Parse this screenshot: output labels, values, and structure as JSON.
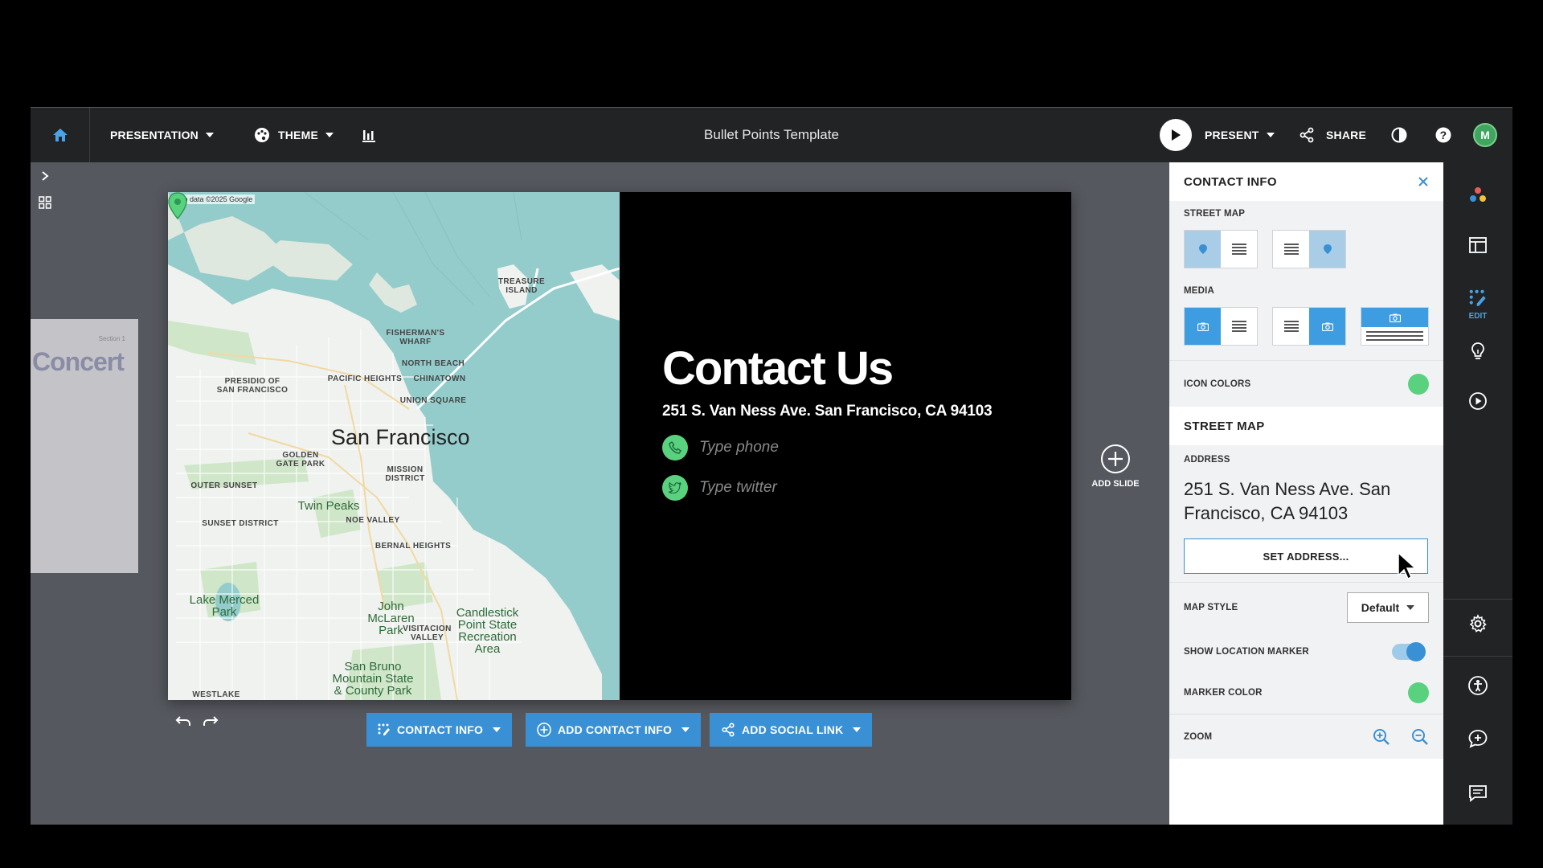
{
  "topbar": {
    "presentation_label": "PRESENTATION",
    "theme_label": "THEME",
    "doc_title": "Bullet Points Template",
    "present_label": "PRESENT",
    "share_label": "SHARE",
    "avatar_initial": "M"
  },
  "thumbnail": {
    "section": "Section 1",
    "title": "Concert"
  },
  "map": {
    "credit": "Map data ©2025 Google",
    "city": "San Francisco",
    "labels": {
      "treasure_island": "TREASURE ISLAND",
      "fishermans_wharf": "FISHERMAN'S WHARF",
      "north_beach": "NORTH BEACH",
      "presidio": "PRESIDIO OF SAN FRANCISCO",
      "pacific_heights": "PACIFIC HEIGHTS",
      "chinatown": "CHINATOWN",
      "union_square": "UNION SQUARE",
      "golden_gate_park": "GOLDEN GATE PARK",
      "mission_district": "MISSION DISTRICT",
      "outer_sunset": "OUTER SUNSET",
      "twin_peaks": "Twin Peaks",
      "noe_valley": "NOE VALLEY",
      "sunset_district": "SUNSET DISTRICT",
      "bernal_heights": "BERNAL HEIGHTS",
      "lake_merced": "Lake Merced Park",
      "mclaren": "John McLaren Park",
      "visitacion": "VISITACION VALLEY",
      "candlestick": "Candlestick Point State Recreation Area",
      "san_bruno": "San Bruno Mountain State & County Park",
      "westlake": "WESTLAKE"
    }
  },
  "slide": {
    "title": "Contact Us",
    "address": "251 S. Van Ness Ave. San Francisco, CA 94103",
    "phone_placeholder": "Type phone",
    "twitter_placeholder": "Type twitter"
  },
  "add_slide_label": "ADD SLIDE",
  "bottom": {
    "contact_info": "CONTACT INFO",
    "add_contact_info": "ADD CONTACT INFO",
    "add_social_link": "ADD SOCIAL LINK"
  },
  "panel": {
    "title": "CONTACT INFO",
    "street_map_label": "STREET MAP",
    "media_label": "MEDIA",
    "icon_colors_label": "ICON COLORS",
    "street_map_section": "STREET MAP",
    "address_label": "ADDRESS",
    "address_value": "251 S. Van Ness Ave. San Francisco, CA 94103",
    "set_address": "SET ADDRESS...",
    "map_style_label": "MAP STYLE",
    "map_style_value": "Default",
    "show_marker_label": "SHOW LOCATION MARKER",
    "show_marker_on": true,
    "marker_color_label": "MARKER COLOR",
    "zoom_label": "ZOOM",
    "icon_color": "#5ad17f",
    "marker_color": "#5ad17f"
  },
  "tools": {
    "edit_label": "EDIT"
  }
}
